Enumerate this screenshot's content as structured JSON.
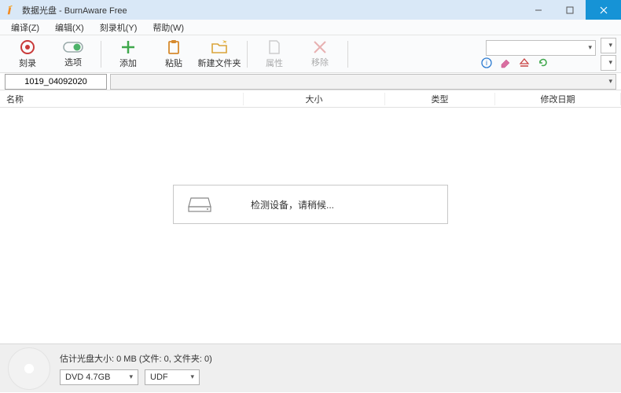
{
  "window": {
    "title": "数据光盘 - BurnAware Free"
  },
  "menu": {
    "translate": "编译(Z)",
    "edit": "编辑(X)",
    "recorder": "刻录机(Y)",
    "help": "帮助(W)"
  },
  "toolbar": {
    "burn": "刻录",
    "options": "选项",
    "add": "添加",
    "paste": "粘贴",
    "newfolder": "新建文件夹",
    "properties": "属性",
    "remove": "移除"
  },
  "disc": {
    "name": "1019_04092020"
  },
  "columns": {
    "name": "名称",
    "size": "大小",
    "type": "类型",
    "modified": "修改日期"
  },
  "detect": {
    "message": "检测设备，请稍候..."
  },
  "status": {
    "estimate": "估计光盘大小: 0 MB (文件: 0, 文件夹: 0)",
    "media": "DVD 4.7GB",
    "fs": "UDF"
  }
}
